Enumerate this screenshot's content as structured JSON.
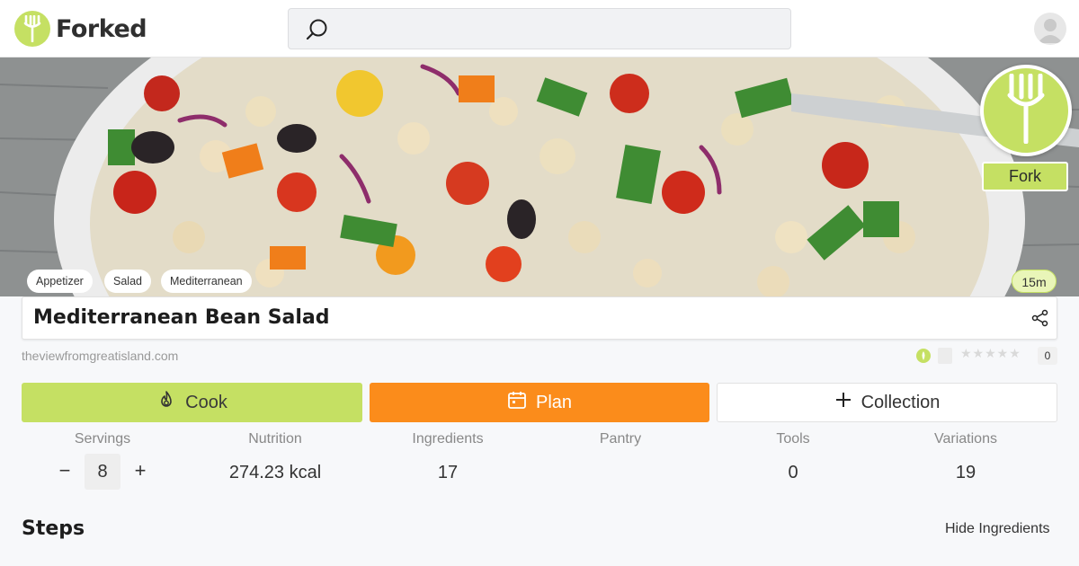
{
  "header": {
    "logo_text": "Forked",
    "search_placeholder": "",
    "search_value": ""
  },
  "hero": {
    "fork_label": "Fork",
    "tags": [
      "Appetizer",
      "Salad",
      "Mediterranean"
    ],
    "time": "15m"
  },
  "recipe": {
    "title": "Mediterranean Bean Salad",
    "source": "theviewfromgreatisland.com",
    "rating_count": "0",
    "rating_stars": "★★★★★"
  },
  "actions": {
    "cook_label": "Cook",
    "plan_label": "Plan",
    "collection_label": "Collection"
  },
  "stats": {
    "servings_label": "Servings",
    "servings_value": "8",
    "minus_symbol": "−",
    "plus_symbol": "+",
    "nutrition_label": "Nutrition",
    "nutrition_value": "274.23 kcal",
    "ingredients_label": "Ingredients",
    "ingredients_value": "17",
    "pantry_label": "Pantry",
    "pantry_value": "",
    "tools_label": "Tools",
    "tools_value": "0",
    "variations_label": "Variations",
    "variations_value": "19"
  },
  "steps": {
    "heading": "Steps",
    "hide_ingredients_label": "Hide Ingredients"
  },
  "colors": {
    "brand_green": "#c5e063",
    "plan_orange": "#fb8c1b",
    "page_background": "#f7f8fa"
  }
}
